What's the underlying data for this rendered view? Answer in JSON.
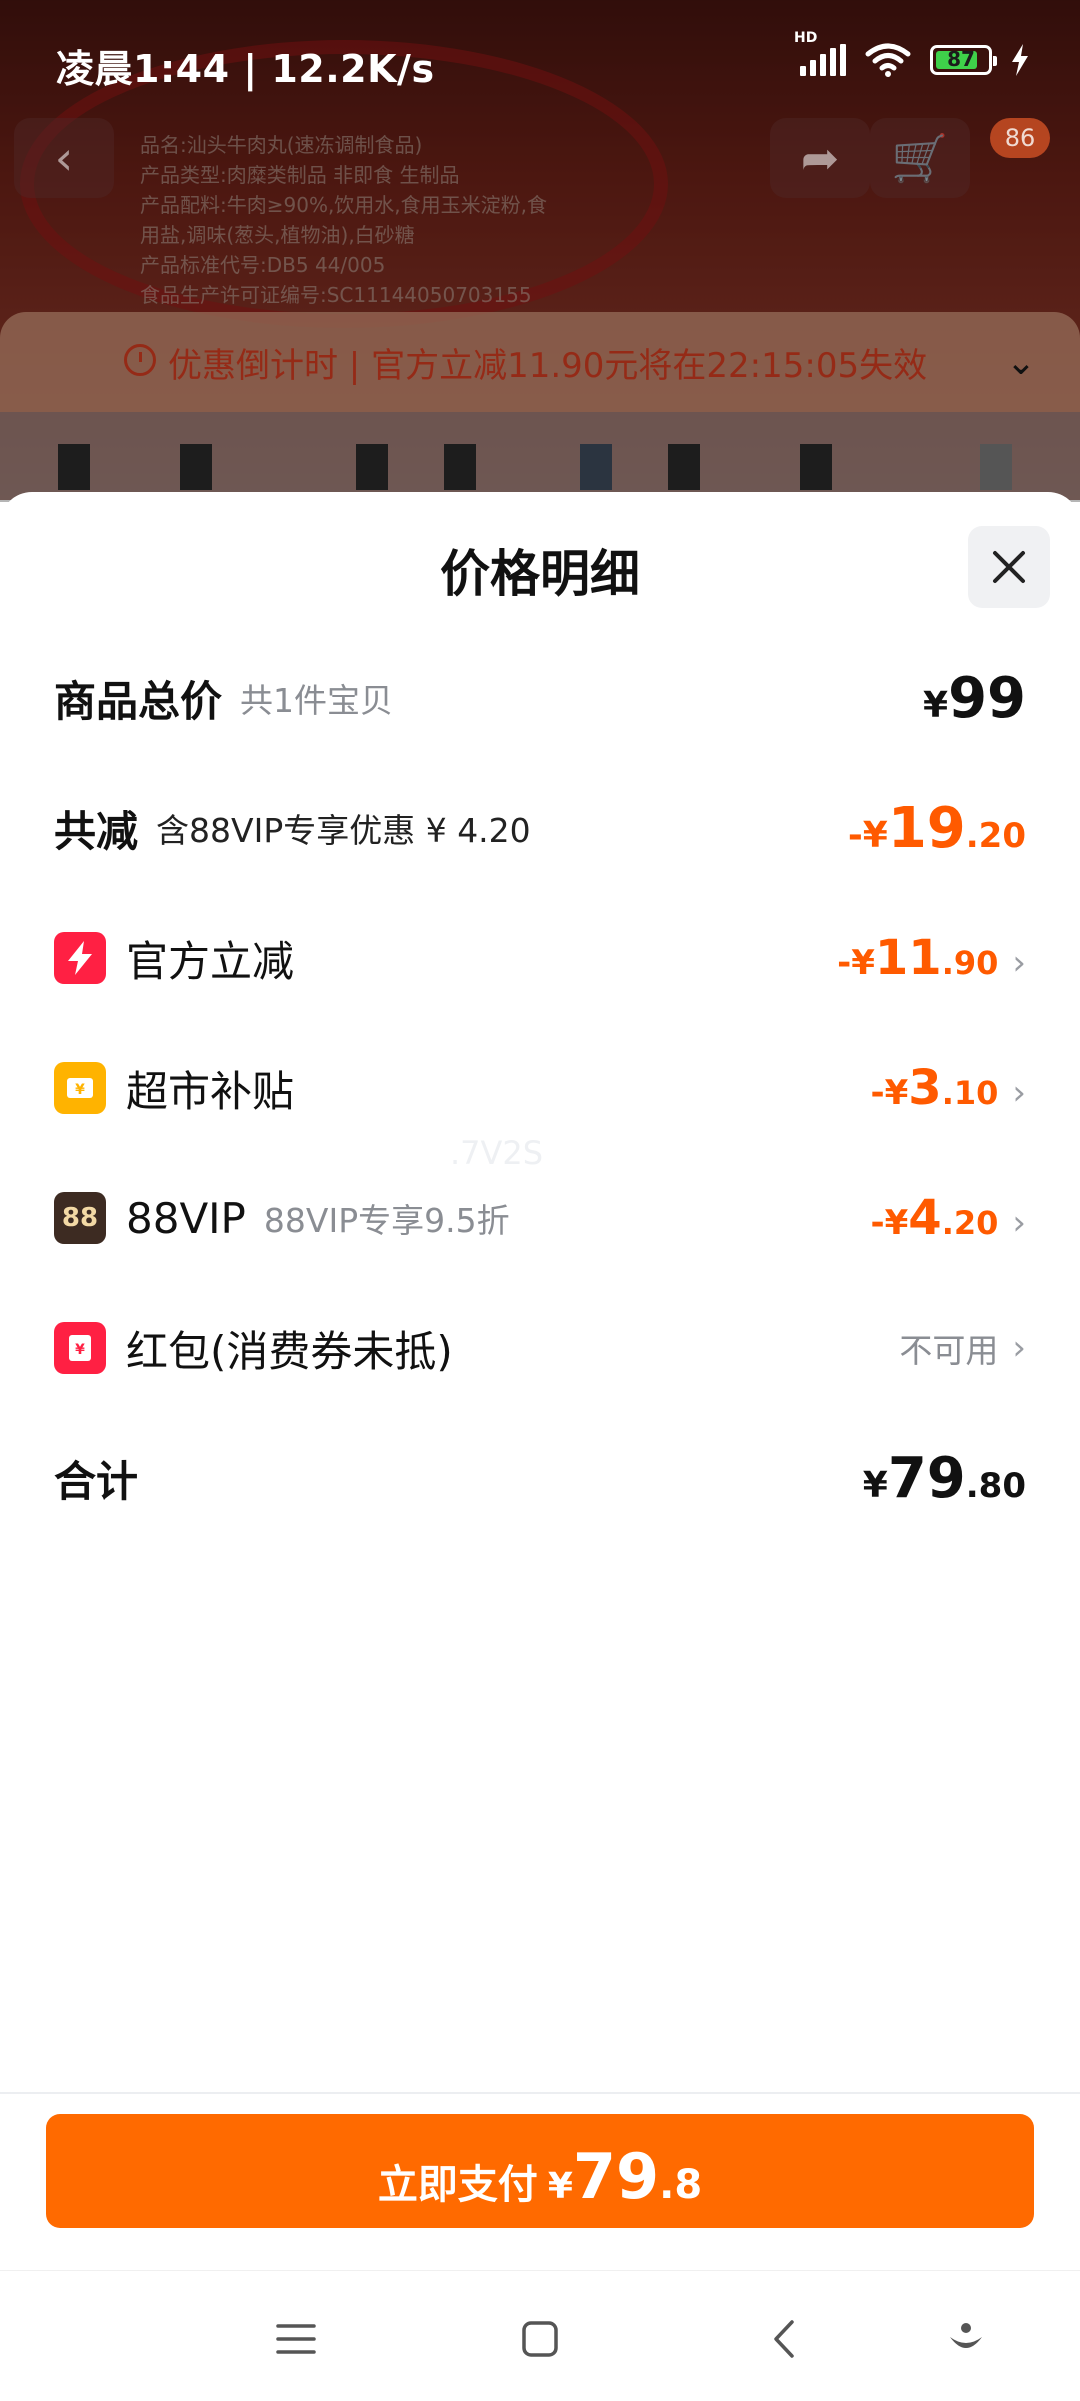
{
  "status_bar": {
    "time": "凌晨1:44 | 12.2K/s",
    "battery": "87"
  },
  "background": {
    "countdown_text": "优惠倒计时 | 官方立减11.90元将在22:15:05失效",
    "cart_badge": "86",
    "package_lines": [
      "品名:汕头牛肉丸(速冻调制食品)",
      "产品类型:肉糜类制品 非即食 生制品",
      "产品配料:牛肉≥90%,饮用水,食用玉米淀粉,食",
      "用盐,调味(葱头,植物油),白砂糖",
      "产品标准代号:DB5 44/005",
      "食品生产许可证编号:SC11144050703155"
    ]
  },
  "sheet": {
    "title": "价格明细",
    "close_label": "×",
    "total_goods": {
      "label": "商品总价",
      "sub": "共1件宝贝",
      "currency": "¥",
      "int": "99",
      "dec": ""
    },
    "total_discount": {
      "label": "共减",
      "sub": "含88VIP专享优惠 ¥ 4.20",
      "currency": "-¥",
      "int": "19",
      "dec": ".20"
    },
    "items": [
      {
        "icon": "lightning-icon",
        "label": "官方立减",
        "sub": "",
        "currency": "-¥",
        "int": "11",
        "dec": ".90"
      },
      {
        "icon": "coupon-icon",
        "label": "超市补贴",
        "sub": "",
        "currency": "-¥",
        "int": "3",
        "dec": ".10"
      },
      {
        "icon": "vip88-icon",
        "icon_text": "88",
        "label": "88VIP",
        "sub": "88VIP专享9.5折",
        "currency": "-¥",
        "int": "4",
        "dec": ".20"
      }
    ],
    "red_packet": {
      "label": "红包(消费券未抵)",
      "status": "不可用"
    },
    "sum": {
      "label": "合计",
      "currency": "¥",
      "int": "79",
      "dec": ".80"
    },
    "watermark": ".7V2S"
  },
  "pay_button": {
    "label": "立即支付",
    "currency": "¥",
    "int": "79",
    "dec": ".8"
  },
  "colors": {
    "accent": "#ff6a00",
    "discount": "#ff5a00",
    "official_icon": "#ff2043",
    "subsidy_icon": "#ffb300",
    "vip_icon": "#3d2b22"
  }
}
